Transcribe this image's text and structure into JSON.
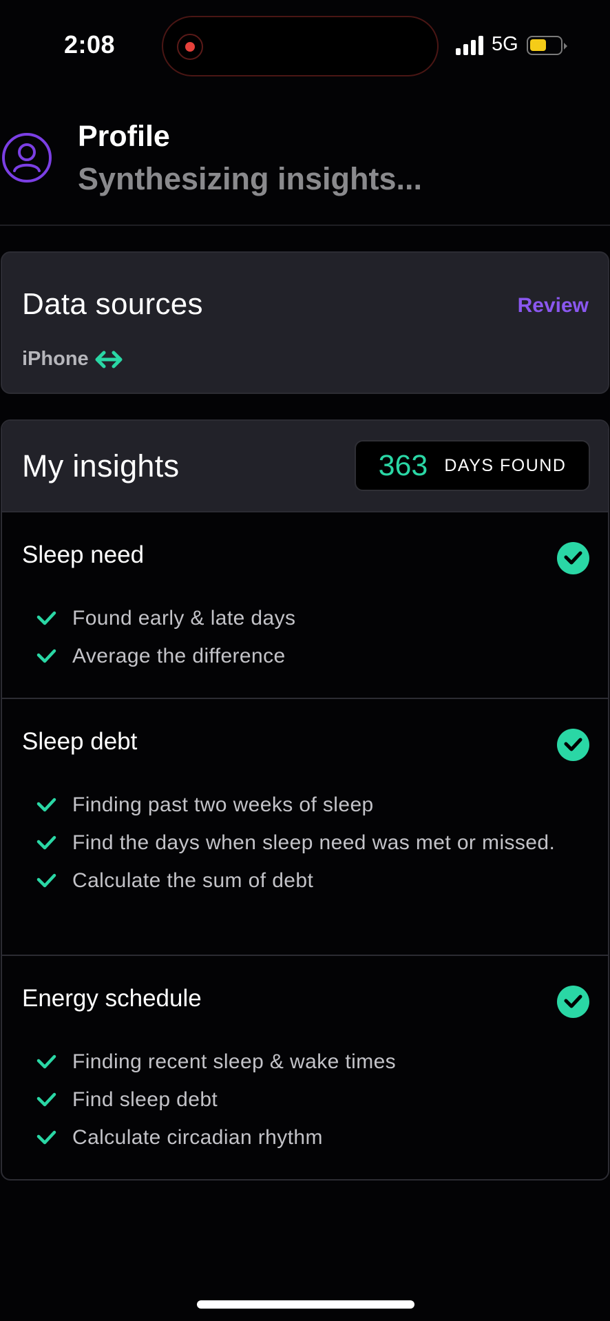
{
  "status_bar": {
    "time": "2:08",
    "network": "5G",
    "signal_bars": 4,
    "battery_level_fraction": 0.45,
    "battery_color": "#f5cc18",
    "recording_indicator_color": "#e5413b"
  },
  "header": {
    "avatar_icon": "user-circle-icon",
    "title": "Profile",
    "subtitle": "Synthesizing insights..."
  },
  "data_sources": {
    "title": "Data sources",
    "review_label": "Review",
    "sources": [
      {
        "name": "iPhone",
        "icon": "sync-arrows-icon"
      }
    ]
  },
  "insights": {
    "title": "My insights",
    "days_found_count": "363",
    "days_found_label": "DAYS FOUND",
    "sections": [
      {
        "title": "Sleep need",
        "complete": true,
        "steps": [
          "Found early & late days",
          "Average the difference"
        ]
      },
      {
        "title": "Sleep debt",
        "complete": true,
        "steps": [
          "Finding past two weeks of sleep",
          "Find the days when sleep need was met or missed.",
          "Calculate the sum of debt"
        ]
      },
      {
        "title": "Energy schedule",
        "complete": true,
        "steps": [
          "Finding recent sleep & wake times",
          "Find sleep debt",
          "Calculate circadian rhythm"
        ]
      }
    ]
  },
  "colors": {
    "accent_purple": "#8a57ef",
    "accent_green": "#2ad7a5",
    "card_bg": "#222229",
    "page_bg": "#030305"
  }
}
